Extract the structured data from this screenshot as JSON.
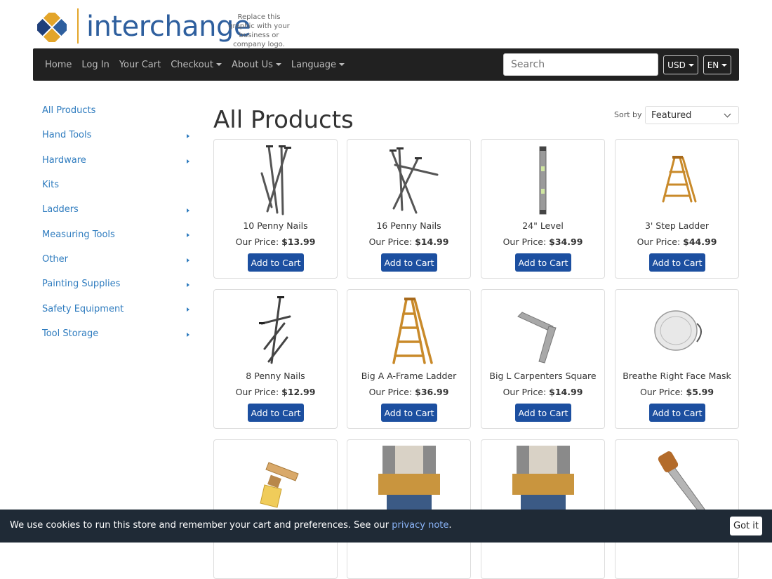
{
  "logo": {
    "text": "interchange",
    "tagline": "Replace this graphic with your business or company logo.",
    "colors": [
      "#e3a52a",
      "#2e5f9e",
      "#1f3f7a"
    ]
  },
  "nav": {
    "items": [
      {
        "label": "Home",
        "dropdown": false
      },
      {
        "label": "Log In",
        "dropdown": false
      },
      {
        "label": "Your Cart",
        "dropdown": false
      },
      {
        "label": "Checkout",
        "dropdown": true
      },
      {
        "label": "About Us",
        "dropdown": true
      },
      {
        "label": "Language",
        "dropdown": true
      }
    ],
    "search_placeholder": "Search",
    "currency": "USD",
    "lang": "EN"
  },
  "sidebar": {
    "items": [
      {
        "label": "All Products",
        "has_children": false
      },
      {
        "label": "Hand Tools",
        "has_children": true
      },
      {
        "label": "Hardware",
        "has_children": true
      },
      {
        "label": "Kits",
        "has_children": false
      },
      {
        "label": "Ladders",
        "has_children": true
      },
      {
        "label": "Measuring Tools",
        "has_children": true
      },
      {
        "label": "Other",
        "has_children": true
      },
      {
        "label": "Painting Supplies",
        "has_children": true
      },
      {
        "label": "Safety Equipment",
        "has_children": true
      },
      {
        "label": "Tool Storage",
        "has_children": true
      }
    ]
  },
  "main": {
    "title": "All Products",
    "sort_label": "Sort by",
    "sort_value": "Featured",
    "price_label": "Our Price:",
    "cart_label": "Add to Cart",
    "products": [
      {
        "name": "10 Penny Nails",
        "price": "$13.99",
        "icon": "nails-icon"
      },
      {
        "name": "16 Penny Nails",
        "price": "$14.99",
        "icon": "nails-icon"
      },
      {
        "name": "24\" Level",
        "price": "$34.99",
        "icon": "level-icon"
      },
      {
        "name": "3' Step Ladder",
        "price": "$44.99",
        "icon": "ladder-icon"
      },
      {
        "name": "8 Penny Nails",
        "price": "$12.99",
        "icon": "nails-icon"
      },
      {
        "name": "Big A A-Frame Ladder",
        "price": "$36.99",
        "icon": "ladder-icon"
      },
      {
        "name": "Big L Carpenters Square",
        "price": "$14.99",
        "icon": "carpenters-square-icon"
      },
      {
        "name": "Breathe Right Face Mask",
        "price": "$5.99",
        "icon": "face-mask-icon"
      },
      {
        "name": "",
        "price": "",
        "icon": "paint-brush-icon"
      },
      {
        "name": "",
        "price": "",
        "icon": "tool-belt-icon"
      },
      {
        "name": "",
        "price": "",
        "icon": "tool-belt-icon"
      },
      {
        "name": "",
        "price": "",
        "icon": "hand-saw-icon"
      }
    ]
  },
  "cookie": {
    "text": "We use cookies to run this store and remember your cart and preferences. See our",
    "link": "privacy note",
    "end": ".",
    "button": "Got it"
  }
}
